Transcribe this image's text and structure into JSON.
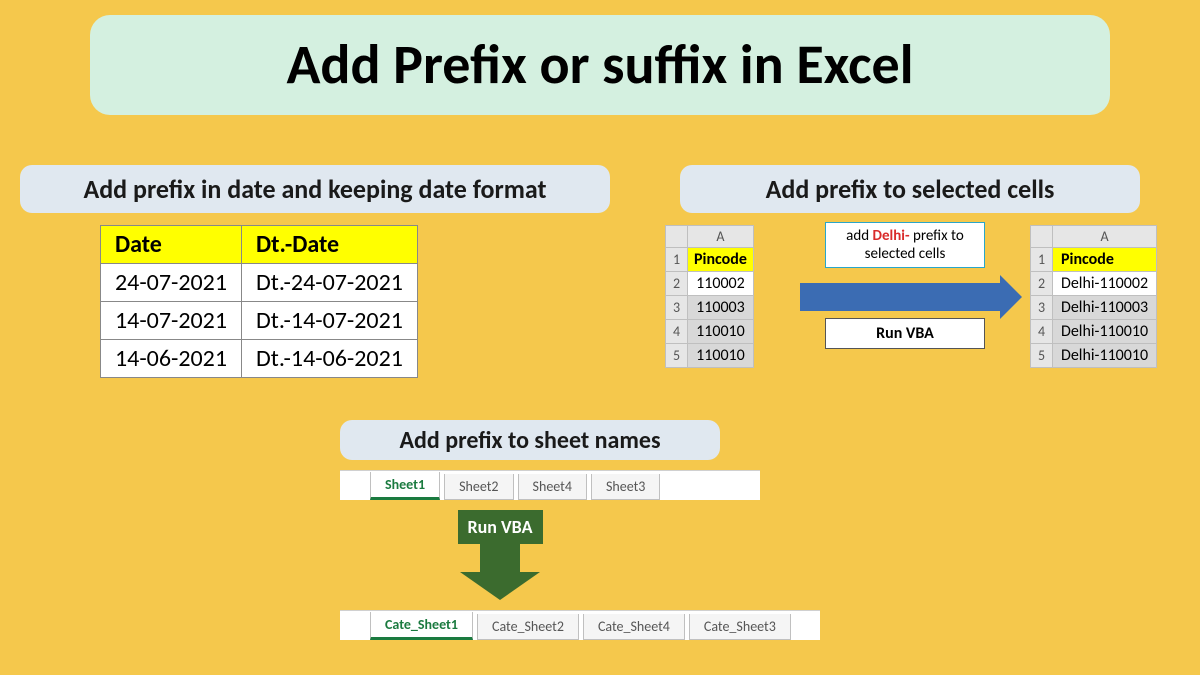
{
  "title": "Add Prefix or suffix in Excel",
  "section1": {
    "banner": "Add prefix in date and keeping date format",
    "headers": [
      "Date",
      "Dt.-Date"
    ],
    "rows": [
      [
        "24-07-2021",
        "Dt.-24-07-2021"
      ],
      [
        "14-07-2021",
        "Dt.-14-07-2021"
      ],
      [
        "14-06-2021",
        "Dt.-14-06-2021"
      ]
    ]
  },
  "section2": {
    "banner": "Add prefix to selected cells",
    "col_letter": "A",
    "left": {
      "header": "Pincode",
      "rows": [
        "110002",
        "110003",
        "110010",
        "110010"
      ]
    },
    "right": {
      "header": "Pincode",
      "rows": [
        "Delhi-110002",
        "Delhi-110003",
        "Delhi-110010",
        "Delhi-110010"
      ]
    },
    "callout_prefix": "Delhi-",
    "callout_before": "add ",
    "callout_after": " prefix to selected cells",
    "run_label": "Run VBA"
  },
  "section3": {
    "banner": "Add prefix to sheet names",
    "tabs_before": [
      "Sheet1",
      "Sheet2",
      "Sheet4",
      "Sheet3"
    ],
    "tabs_after": [
      "Cate_Sheet1",
      "Cate_Sheet2",
      "Cate_Sheet4",
      "Cate_Sheet3"
    ],
    "run_label": "Run VBA"
  }
}
